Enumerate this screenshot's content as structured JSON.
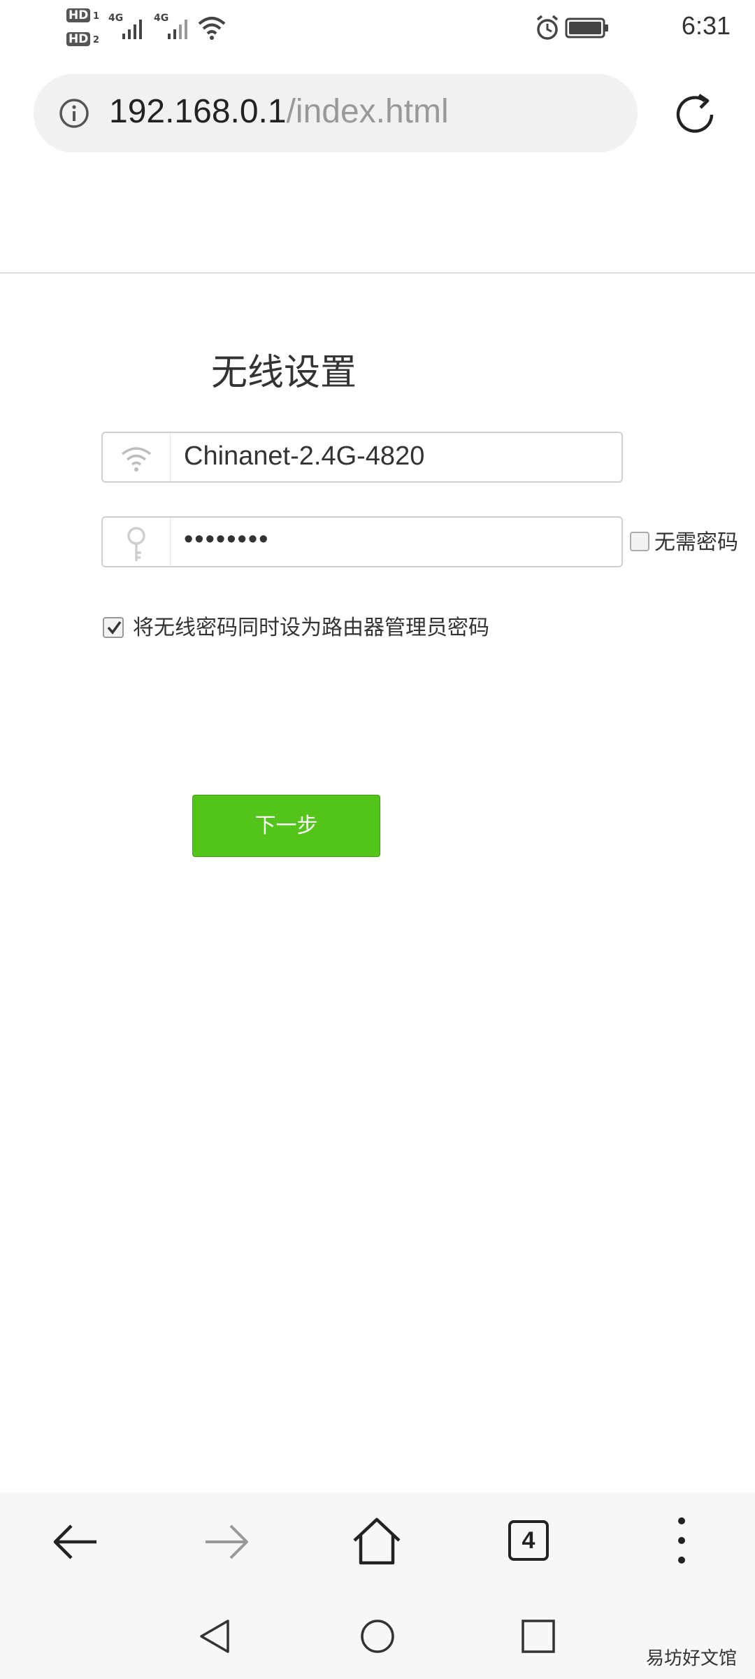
{
  "status_bar": {
    "hd1": "HD",
    "hd1_sub": "1",
    "hd2": "HD",
    "hd2_sub": "2",
    "net1": "4G",
    "net2": "4G",
    "time": "6:31",
    "icons": [
      "signal-icon",
      "wifi-icon",
      "alarm-icon",
      "battery-icon"
    ]
  },
  "address_bar": {
    "url_host": "192.168.0.1",
    "url_path": "/index.html"
  },
  "page": {
    "title": "无线设置",
    "ssid_value": "Chinanet-2.4G-4820",
    "password_value": "••••••••",
    "no_password_label": "无需密码",
    "no_password_checked": false,
    "sync_admin_label": "将无线密码同时设为路由器管理员密码",
    "sync_admin_checked": true,
    "next_button_label": "下一步",
    "next_button_color": "#52c41a"
  },
  "toolbar": {
    "tab_count": "4",
    "icons": [
      "back-arrow-icon",
      "forward-arrow-icon",
      "home-icon",
      "tabs-icon",
      "more-menu-icon"
    ]
  },
  "system_nav": {
    "icons": [
      "nav-back-icon",
      "nav-home-icon",
      "nav-recents-icon"
    ]
  },
  "watermark": "易坊好文馆"
}
